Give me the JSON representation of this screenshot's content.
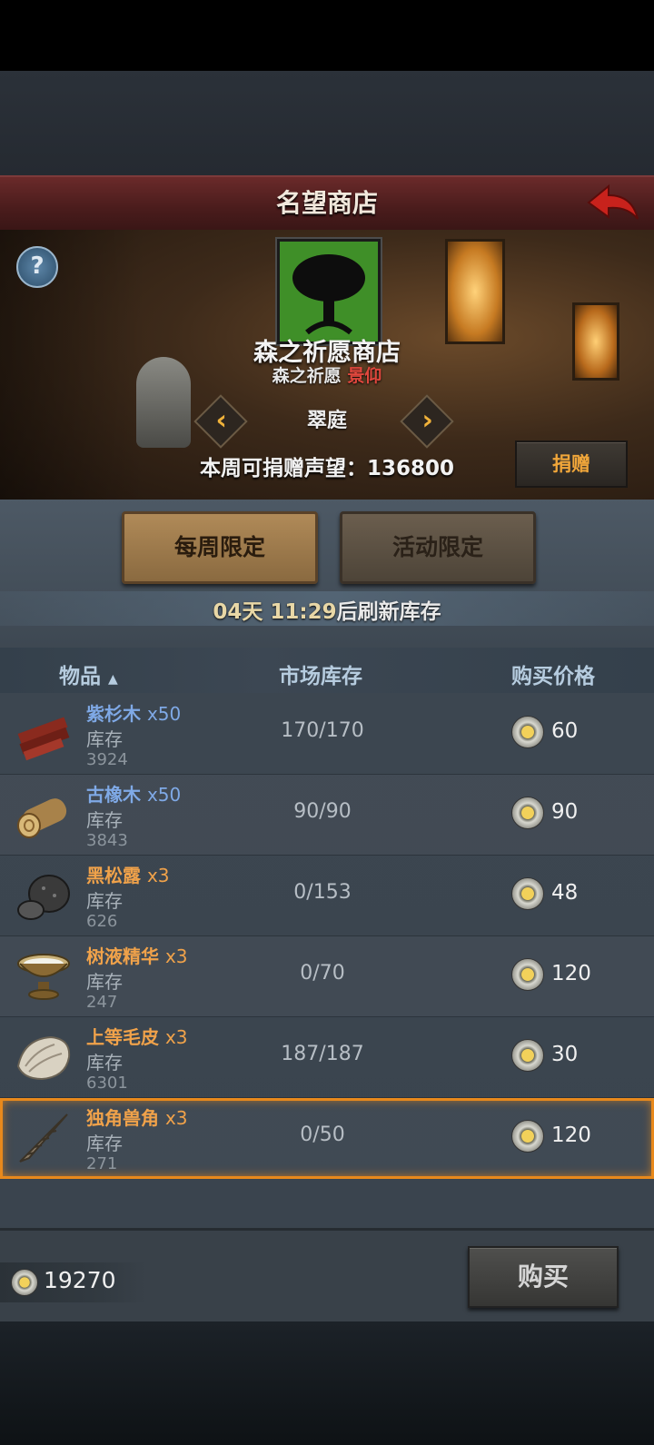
{
  "header": {
    "title": "名望商店"
  },
  "shop": {
    "name": "森之祈愿商店",
    "faction": "森之祈愿",
    "rank": "景仰",
    "region": "翠庭",
    "donate_text": "本周可捐赠声望：136800",
    "donate_label": "捐赠",
    "help_label": "?"
  },
  "tabs": [
    {
      "label": "每周限定",
      "active": true
    },
    {
      "label": "活动限定",
      "active": false
    }
  ],
  "refresh": {
    "time": "04天 11:29",
    "text": "后刷新库存"
  },
  "columns": {
    "item": "物品",
    "sort_arrow": "▲",
    "market": "市场库存",
    "price": "购买价格"
  },
  "items": [
    {
      "name": "紫杉木",
      "qty": "x50",
      "stock_label": "库存",
      "stock": "3924",
      "market": "170/170",
      "price": "60",
      "color": "blue",
      "icon": "yew-wood-icon"
    },
    {
      "name": "古橡木",
      "qty": "x50",
      "stock_label": "库存",
      "stock": "3843",
      "market": "90/90",
      "price": "90",
      "color": "blue",
      "icon": "oak-log-icon"
    },
    {
      "name": "黑松露",
      "qty": "x3",
      "stock_label": "库存",
      "stock": "626",
      "market": "0/153",
      "price": "48",
      "color": "orange",
      "icon": "truffle-icon"
    },
    {
      "name": "树液精华",
      "qty": "x3",
      "stock_label": "库存",
      "stock": "247",
      "market": "0/70",
      "price": "120",
      "color": "orange",
      "icon": "sap-bowl-icon"
    },
    {
      "name": "上等毛皮",
      "qty": "x3",
      "stock_label": "库存",
      "stock": "6301",
      "market": "187/187",
      "price": "30",
      "color": "orange",
      "icon": "fur-pelt-icon"
    },
    {
      "name": "独角兽角",
      "qty": "x3",
      "stock_label": "库存",
      "stock": "271",
      "market": "0/50",
      "price": "120",
      "color": "orange",
      "icon": "unicorn-horn-icon",
      "selected": true
    }
  ],
  "footer": {
    "currency": "19270",
    "buy_label": "购买"
  }
}
